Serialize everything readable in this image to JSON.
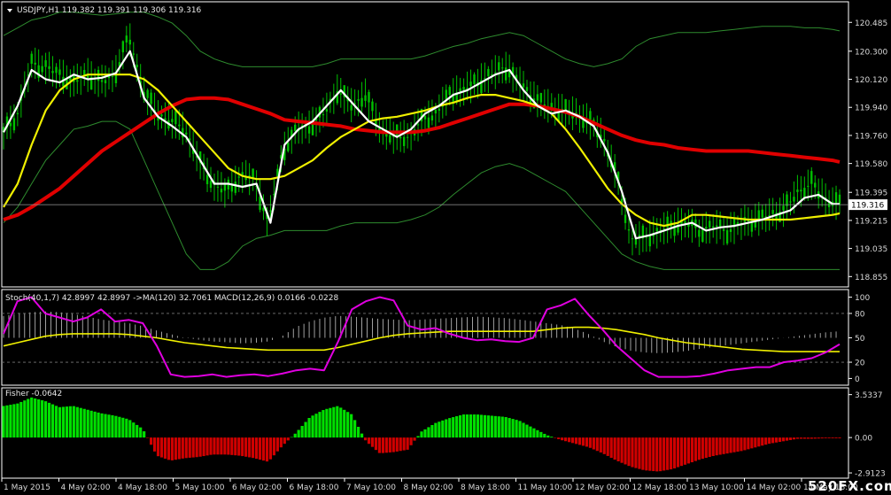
{
  "header": {
    "main": "USDJPY,H1  119.382 119.391 119.306 119.316",
    "sub1": "Stoch(40,1,7) 42.8997 42.8997  ->MA(120) 32.7061  MACD(12,26,9) 0.0166 -0.0228",
    "sub2": "Fisher -0.0642",
    "menu_icon": "triangle-down-icon"
  },
  "watermark": "520FX.com",
  "colors": {
    "background": "#000000",
    "price_candles": "#00c000",
    "white_ma": "#ffffff",
    "yellow_ma": "#f0f000",
    "red_ma": "#e00000",
    "bands": "#2e8b2e",
    "stoch": "#e000e0",
    "stoch_ma": "#f0f000",
    "macd_hist": "#c8c8c8",
    "fisher_up": "#00e000",
    "fisher_down": "#d00000",
    "axis": "#ffffff"
  },
  "chart_data": [
    {
      "type": "line",
      "name": "USDJPY,H1 price panel",
      "ohlc_last": {
        "open": 119.382,
        "high": 119.391,
        "low": 119.306,
        "close": 119.316
      },
      "ylim": [
        118.8,
        120.6
      ],
      "ytick_labels": [
        "120.485",
        "120.300",
        "120.120",
        "119.940",
        "119.760",
        "119.580",
        "119.395",
        "119.215",
        "119.035",
        "118.855"
      ],
      "ytick_values": [
        120.485,
        120.3,
        120.12,
        119.94,
        119.76,
        119.58,
        119.395,
        119.215,
        119.035,
        118.855
      ],
      "current_price_label": "119.316",
      "current_price": 119.316,
      "xtick_labels": [
        "1 May 2015",
        "4 May 02:00",
        "4 May 18:00",
        "5 May 10:00",
        "6 May 02:00",
        "6 May 18:00",
        "7 May 10:00",
        "8 May 02:00",
        "8 May 18:00",
        "11 May 10:00",
        "12 May 02:00",
        "12 May 18:00",
        "13 May 10:00",
        "14 May 02:00",
        "14 May 18:00"
      ],
      "x": [
        0,
        4,
        8,
        12,
        16,
        20,
        24,
        28,
        32,
        36,
        40,
        44,
        48,
        52,
        56,
        60,
        64,
        68,
        72,
        76,
        80,
        84,
        88,
        92,
        96,
        100,
        104,
        108,
        112,
        116,
        120,
        124,
        128,
        132,
        136,
        140,
        144,
        148,
        152,
        156,
        160,
        164,
        168,
        172,
        176,
        180,
        184,
        188,
        192,
        196,
        200,
        204,
        208,
        212,
        216,
        220,
        224,
        228,
        232,
        236,
        238
      ],
      "series": [
        {
          "key": "close",
          "values": [
            119.78,
            119.9,
            120.22,
            120.2,
            120.15,
            120.1,
            120.15,
            120.1,
            120.15,
            120.4,
            120.05,
            119.9,
            119.85,
            119.8,
            119.6,
            119.45,
            119.4,
            119.5,
            119.48,
            119.2,
            119.65,
            119.8,
            119.82,
            119.9,
            120.05,
            119.95,
            120.02,
            119.8,
            119.75,
            119.75,
            119.85,
            119.9,
            120.02,
            120.05,
            120.1,
            120.15,
            120.2,
            120.1,
            120.0,
            119.95,
            119.92,
            119.9,
            119.85,
            119.75,
            119.5,
            119.1,
            119.1,
            119.15,
            119.18,
            119.2,
            119.15,
            119.18,
            119.15,
            119.2,
            119.22,
            119.25,
            119.28,
            119.4,
            119.45,
            119.35,
            119.32
          ]
        },
        {
          "key": "white_ma",
          "values": [
            119.78,
            119.95,
            120.18,
            120.12,
            120.1,
            120.15,
            120.12,
            120.13,
            120.16,
            120.3,
            120.0,
            119.88,
            119.82,
            119.75,
            119.6,
            119.45,
            119.45,
            119.43,
            119.45,
            119.2,
            119.7,
            119.8,
            119.85,
            119.95,
            120.05,
            119.95,
            119.85,
            119.8,
            119.75,
            119.8,
            119.9,
            119.95,
            120.02,
            120.05,
            120.1,
            120.15,
            120.18,
            120.05,
            119.95,
            119.9,
            119.92,
            119.88,
            119.82,
            119.65,
            119.4,
            119.1,
            119.12,
            119.15,
            119.18,
            119.2,
            119.15,
            119.17,
            119.18,
            119.2,
            119.22,
            119.25,
            119.28,
            119.36,
            119.38,
            119.32,
            119.32
          ]
        },
        {
          "key": "yellow_ma",
          "values": [
            119.3,
            119.45,
            119.7,
            119.92,
            120.05,
            120.12,
            120.15,
            120.15,
            120.15,
            120.15,
            120.12,
            120.05,
            119.95,
            119.85,
            119.75,
            119.65,
            119.55,
            119.5,
            119.48,
            119.48,
            119.5,
            119.55,
            119.6,
            119.68,
            119.75,
            119.8,
            119.85,
            119.87,
            119.88,
            119.9,
            119.92,
            119.95,
            119.97,
            120.0,
            120.02,
            120.02,
            120.0,
            119.98,
            119.95,
            119.9,
            119.8,
            119.68,
            119.55,
            119.42,
            119.32,
            119.25,
            119.2,
            119.18,
            119.2,
            119.25,
            119.25,
            119.24,
            119.23,
            119.22,
            119.22,
            119.22,
            119.22,
            119.23,
            119.24,
            119.25,
            119.26
          ]
        },
        {
          "key": "red_ma",
          "values": [
            119.22,
            119.25,
            119.3,
            119.36,
            119.42,
            119.5,
            119.58,
            119.66,
            119.72,
            119.78,
            119.84,
            119.9,
            119.95,
            119.99,
            120.0,
            120.0,
            119.99,
            119.96,
            119.93,
            119.9,
            119.86,
            119.85,
            119.84,
            119.83,
            119.82,
            119.8,
            119.79,
            119.78,
            119.78,
            119.78,
            119.79,
            119.81,
            119.84,
            119.87,
            119.9,
            119.93,
            119.96,
            119.96,
            119.95,
            119.93,
            119.91,
            119.88,
            119.84,
            119.8,
            119.76,
            119.73,
            119.71,
            119.7,
            119.68,
            119.67,
            119.66,
            119.66,
            119.66,
            119.66,
            119.65,
            119.64,
            119.63,
            119.62,
            119.61,
            119.6,
            119.59
          ]
        },
        {
          "key": "band_upper",
          "values": [
            120.4,
            120.45,
            120.5,
            120.52,
            120.55,
            120.55,
            120.54,
            120.53,
            120.54,
            120.55,
            120.55,
            120.52,
            120.48,
            120.4,
            120.3,
            120.25,
            120.22,
            120.2,
            120.2,
            120.2,
            120.2,
            120.2,
            120.2,
            120.22,
            120.25,
            120.25,
            120.25,
            120.25,
            120.25,
            120.25,
            120.27,
            120.3,
            120.33,
            120.35,
            120.38,
            120.4,
            120.42,
            120.4,
            120.35,
            120.3,
            120.25,
            120.22,
            120.2,
            120.22,
            120.25,
            120.33,
            120.38,
            120.4,
            120.42,
            120.42,
            120.42,
            120.43,
            120.44,
            120.45,
            120.46,
            120.46,
            120.46,
            120.45,
            120.45,
            120.44,
            120.43
          ]
        },
        {
          "key": "band_lower",
          "values": [
            119.2,
            119.3,
            119.45,
            119.6,
            119.7,
            119.8,
            119.82,
            119.85,
            119.85,
            119.8,
            119.6,
            119.4,
            119.2,
            119.0,
            118.9,
            118.9,
            118.95,
            119.05,
            119.1,
            119.12,
            119.15,
            119.15,
            119.15,
            119.15,
            119.18,
            119.2,
            119.2,
            119.2,
            119.2,
            119.22,
            119.25,
            119.3,
            119.38,
            119.45,
            119.52,
            119.56,
            119.58,
            119.55,
            119.5,
            119.45,
            119.4,
            119.3,
            119.2,
            119.1,
            119.0,
            118.95,
            118.92,
            118.9,
            118.9,
            118.9,
            118.9,
            118.9,
            118.9,
            118.9,
            118.9,
            118.9,
            118.9,
            118.9,
            118.9,
            118.9,
            118.9
          ]
        }
      ]
    },
    {
      "type": "line",
      "name": "Stoch / MACD panel",
      "params": "Stoch(40,1,7) 42.8997 42.8997  ->MA(120) 32.7061  MACD(12,26,9) 0.0166 -0.0228",
      "ylim": [
        -5,
        105
      ],
      "ytick_labels": [
        "100",
        "80",
        "50",
        "20",
        "0"
      ],
      "ytick_values": [
        100,
        80,
        50,
        20,
        0
      ],
      "level_lines": [
        80,
        20
      ],
      "stoch": [
        55,
        95,
        100,
        80,
        75,
        70,
        75,
        85,
        70,
        72,
        68,
        40,
        5,
        2,
        3,
        5,
        2,
        4,
        5,
        3,
        6,
        10,
        12,
        10,
        45,
        85,
        95,
        100,
        96,
        65,
        60,
        62,
        55,
        50,
        47,
        48,
        46,
        45,
        50,
        85,
        90,
        98,
        78,
        60,
        40,
        25,
        10,
        2,
        2,
        2,
        3,
        6,
        10,
        12,
        14,
        14,
        20,
        22,
        25,
        32,
        42
      ],
      "stoch_ma": [
        40,
        44,
        48,
        52,
        54,
        55,
        55,
        55,
        55,
        54,
        52,
        50,
        47,
        44,
        42,
        40,
        38,
        37,
        36,
        35,
        35,
        35,
        35,
        35,
        38,
        42,
        46,
        50,
        53,
        55,
        56,
        57,
        58,
        58,
        58,
        58,
        58,
        58,
        58,
        60,
        62,
        63,
        63,
        62,
        60,
        57,
        54,
        50,
        47,
        44,
        42,
        40,
        38,
        36,
        35,
        34,
        33,
        33,
        33,
        33,
        33
      ],
      "macd_hist": [
        60,
        65,
        70,
        72,
        70,
        65,
        58,
        50,
        45,
        40,
        32,
        20,
        10,
        0,
        -5,
        -10,
        -12,
        -15,
        -14,
        -10,
        5,
        30,
        45,
        55,
        60,
        58,
        55,
        52,
        50,
        48,
        50,
        52,
        54,
        56,
        58,
        56,
        54,
        50,
        45,
        40,
        35,
        25,
        10,
        -10,
        -25,
        -35,
        -40,
        -42,
        -40,
        -36,
        -30,
        -25,
        -20,
        -15,
        -10,
        -5,
        0,
        5,
        10,
        15,
        18
      ]
    },
    {
      "type": "bar",
      "name": "Fisher panel",
      "params": "Fisher -0.0642",
      "ylim": [
        -3.2,
        3.8
      ],
      "ytick_labels": [
        "3.5337",
        "0.00",
        "-2.9123"
      ],
      "ytick_values": [
        3.5337,
        0,
        -2.9123
      ],
      "values": [
        2.6,
        2.8,
        3.3,
        3.0,
        2.5,
        2.6,
        2.3,
        2.0,
        1.8,
        1.5,
        0.7,
        -1.5,
        -1.9,
        -1.7,
        -1.6,
        -1.4,
        -1.4,
        -1.5,
        -1.7,
        -2.0,
        -0.7,
        0.4,
        1.7,
        2.3,
        2.6,
        1.9,
        -0.3,
        -1.3,
        -1.2,
        -1.0,
        0.5,
        1.2,
        1.6,
        1.9,
        1.9,
        1.8,
        1.7,
        1.4,
        0.8,
        0.2,
        -0.2,
        -0.5,
        -0.8,
        -1.3,
        -1.9,
        -2.4,
        -2.7,
        -2.8,
        -2.6,
        -2.2,
        -1.8,
        -1.5,
        -1.3,
        -1.1,
        -0.8,
        -0.5,
        -0.3,
        -0.1,
        -0.1,
        -0.06,
        -0.0642
      ]
    }
  ]
}
